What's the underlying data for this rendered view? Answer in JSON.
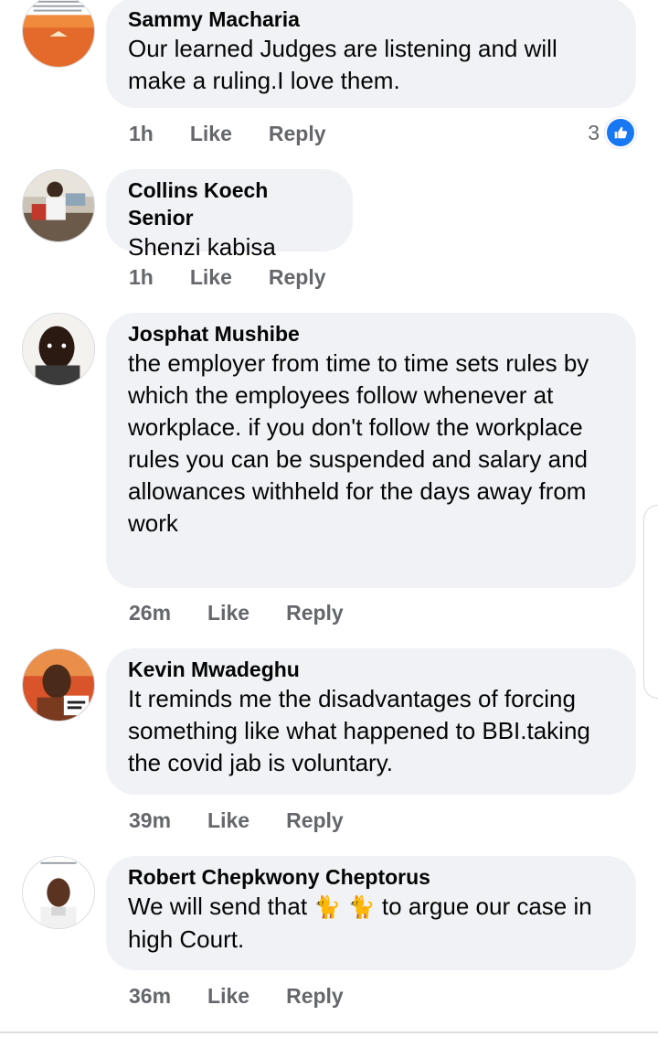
{
  "comments": [
    {
      "author": "Sammy Macharia",
      "text": "Our learned Judges are listening and will make a ruling.I love them.",
      "time": "1h",
      "like_label": "Like",
      "reply_label": "Reply",
      "reaction_count": "3",
      "avatar_icon": "desert-landscape-avatar"
    },
    {
      "author": "Collins Koech Senior",
      "text": "Shenzi kabisa",
      "time": "1h",
      "like_label": "Like",
      "reply_label": "Reply",
      "avatar_icon": "person-photo-avatar"
    },
    {
      "author": "Josphat Mushibe",
      "text": "the employer from time to time sets rules by which the employees follow whenever at workplace. if you don't follow the workplace rules you can be suspended and salary and allowances withheld for the days away from work",
      "time": "26m",
      "like_label": "Like",
      "reply_label": "Reply",
      "avatar_icon": "person-photo-avatar"
    },
    {
      "author": "Kevin Mwadeghu",
      "text": "It reminds me the disadvantages of forcing something like what happened to BBI.taking the covid jab is voluntary.",
      "time": "39m",
      "like_label": "Like",
      "reply_label": "Reply",
      "avatar_icon": "person-photo-avatar"
    },
    {
      "author": "Robert Chepkwony Cheptorus",
      "text_before": "We will send that ",
      "emoji": "🐈 🐈",
      "text_after": " to argue our case in high Court.",
      "time": "36m",
      "like_label": "Like",
      "reply_label": "Reply",
      "avatar_icon": "person-photo-avatar"
    }
  ],
  "colors": {
    "bubble": "#f0f2f5",
    "secondary_text": "#65676b",
    "like_blue": "#1877f2"
  }
}
